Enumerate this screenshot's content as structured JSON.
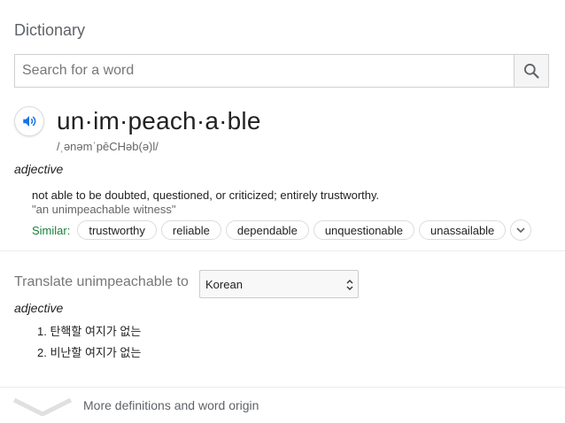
{
  "panel": {
    "title": "Dictionary",
    "search": {
      "placeholder": "Search for a word",
      "value": ""
    },
    "headword": "un·im·peach·a·ble",
    "phonetic": "/ˌənəmˈpēCHəb(ə)l/",
    "part_of_speech": "adjective",
    "definition": "not able to be doubted, questioned, or criticized; entirely trustworthy.",
    "example": "\"an unimpeachable witness\"",
    "similar_label": "Similar:",
    "similar": [
      "trustworthy",
      "reliable",
      "dependable",
      "unquestionable",
      "unassailable"
    ],
    "translate": {
      "label": "Translate unimpeachable to",
      "language": "Korean",
      "part_of_speech": "adjective",
      "items": [
        "1. 탄핵할 여지가 없는",
        "2. 비난할 여지가 없는"
      ]
    },
    "more_link": "More definitions and word origin"
  },
  "colors": {
    "accent_blue": "#1a73e8",
    "similar_green": "#188038",
    "muted_text": "#5f6368",
    "chip_border": "#dadce0"
  },
  "icons": {
    "search": "search-icon",
    "speaker": "speaker-icon",
    "expand": "chevron-down-icon",
    "select": "select-arrows-icon",
    "more": "chevron-down-large-icon"
  }
}
